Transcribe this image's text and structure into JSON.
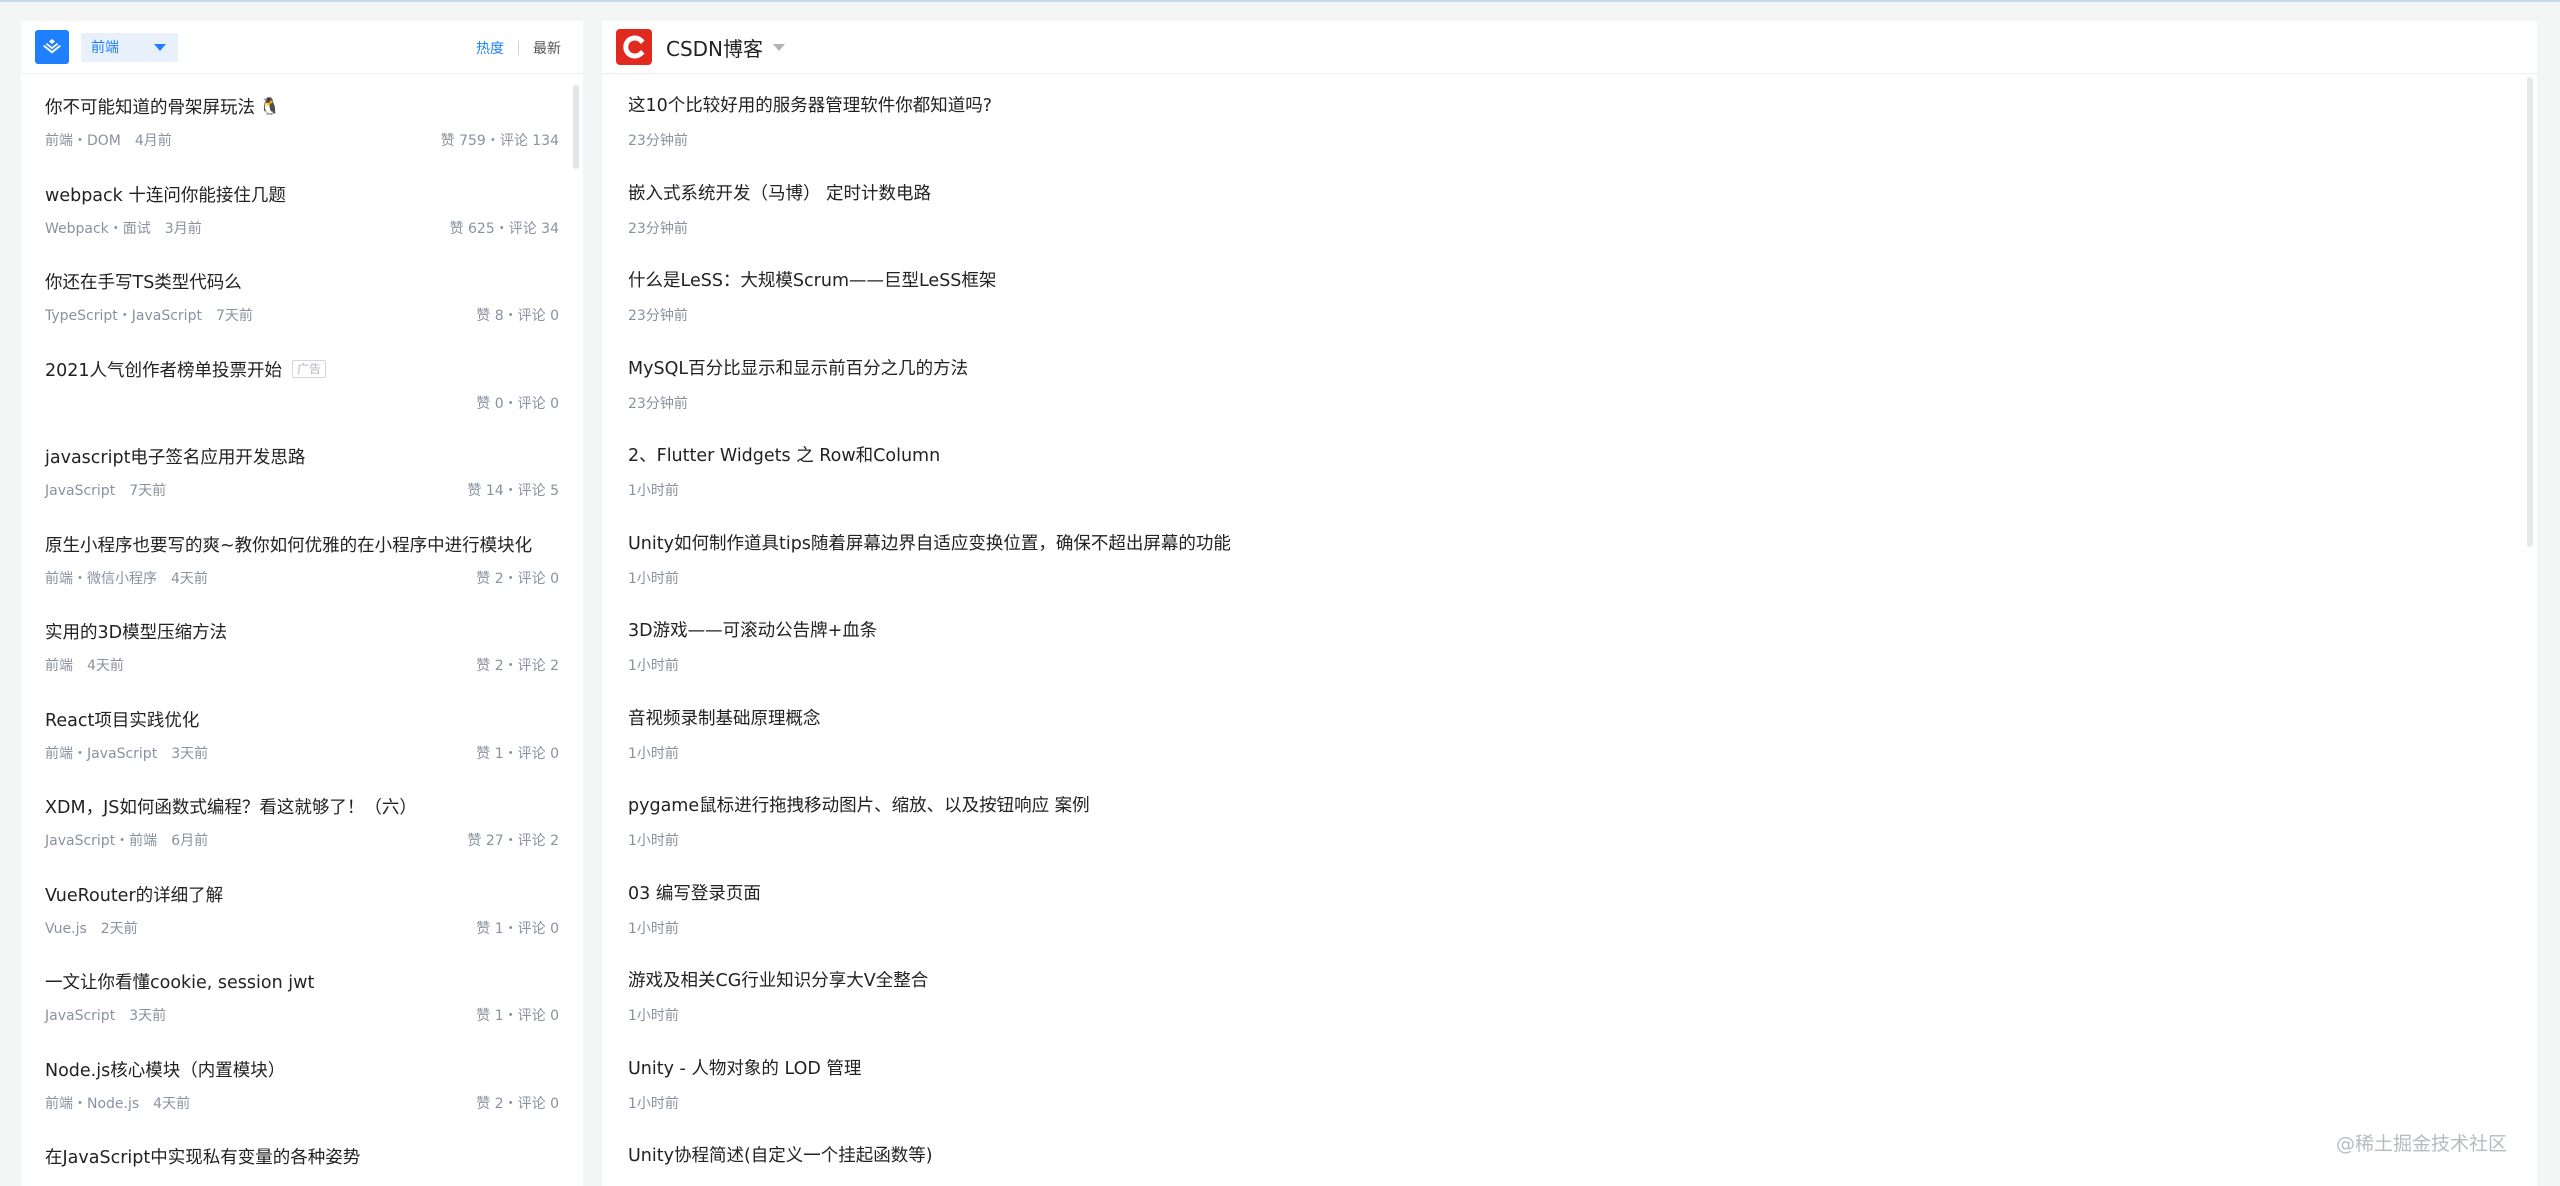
{
  "left_panel": {
    "category_select": "前端",
    "sort_tabs": [
      {
        "label": "热度",
        "active": true
      },
      {
        "label": "最新",
        "active": false
      }
    ],
    "articles": [
      {
        "title": "你不可能知道的骨架屏玩法",
        "emoji": "🐧",
        "tags": "前端・DOM",
        "age": "4月前",
        "stats": "赞 759・评论 134"
      },
      {
        "title": "webpack 十连问你能接住几题",
        "tags": "Webpack・面试",
        "age": "3月前",
        "stats": "赞 625・评论 34"
      },
      {
        "title": "你还在手写TS类型代码么",
        "tags": "TypeScript・JavaScript",
        "age": "7天前",
        "stats": "赞 8・评论 0"
      },
      {
        "title": "2021人气创作者榜单投票开始",
        "ad": "广告",
        "tags": "",
        "age": "",
        "stats": "赞 0・评论 0"
      },
      {
        "title": "javascript电子签名应用开发思路",
        "tags": "JavaScript",
        "age": "7天前",
        "stats": "赞 14・评论 5"
      },
      {
        "title": "原生小程序也要写的爽~教你如何优雅的在小程序中进行模块化",
        "tags": "前端・微信小程序",
        "age": "4天前",
        "stats": "赞 2・评论 0"
      },
      {
        "title": "实用的3D模型压缩方法",
        "tags": "前端",
        "age": "4天前",
        "stats": "赞 2・评论 2"
      },
      {
        "title": "React项目实践优化",
        "tags": "前端・JavaScript",
        "age": "3天前",
        "stats": "赞 1・评论 0"
      },
      {
        "title": "XDM，JS如何函数式编程？看这就够了！（六）",
        "tags": "JavaScript・前端",
        "age": "6月前",
        "stats": "赞 27・评论 2"
      },
      {
        "title": "VueRouter的详细了解",
        "tags": "Vue.js",
        "age": "2天前",
        "stats": "赞 1・评论 0"
      },
      {
        "title": "一文让你看懂cookie, session jwt",
        "tags": "JavaScript",
        "age": "3天前",
        "stats": "赞 1・评论 0"
      },
      {
        "title": "Node.js核心模块（内置模块）",
        "tags": "前端・Node.js",
        "age": "4天前",
        "stats": "赞 2・评论 0"
      },
      {
        "title": "在JavaScript中实现私有变量的各种姿势",
        "tags": "",
        "age": "",
        "stats": ""
      }
    ]
  },
  "right_panel": {
    "source_name": "CSDN博客",
    "items": [
      {
        "title": "这10个比较好用的服务器管理软件你都知道吗?",
        "time": "23分钟前"
      },
      {
        "title": "嵌入式系统开发（马博） 定时计数电路",
        "time": "23分钟前"
      },
      {
        "title": "什么是LeSS：大规模Scrum——巨型LeSS框架",
        "time": "23分钟前"
      },
      {
        "title": "MySQL百分比显示和显示前百分之几的方法",
        "time": "23分钟前"
      },
      {
        "title": "2、Flutter Widgets 之 Row和Column",
        "time": "1小时前"
      },
      {
        "title": "Unity如何制作道具tips随着屏幕边界自适应变换位置，确保不超出屏幕的功能",
        "time": "1小时前"
      },
      {
        "title": "3D游戏——可滚动公告牌+血条",
        "time": "1小时前"
      },
      {
        "title": "音视频录制基础原理概念",
        "time": "1小时前"
      },
      {
        "title": "pygame鼠标进行拖拽移动图片、缩放、以及按钮响应 案例",
        "time": "1小时前"
      },
      {
        "title": "03 编写登录页面",
        "time": "1小时前"
      },
      {
        "title": "游戏及相关CG行业知识分享大V全整合",
        "time": "1小时前"
      },
      {
        "title": "Unity - 人物对象的 LOD 管理",
        "time": "1小时前"
      },
      {
        "title": "Unity协程简述(自定义一个挂起函数等)",
        "time": ""
      }
    ]
  },
  "watermark": "@稀土掘金技术社区",
  "colors": {
    "accent": "#1e80ff",
    "csdn_red": "#e02a20"
  }
}
